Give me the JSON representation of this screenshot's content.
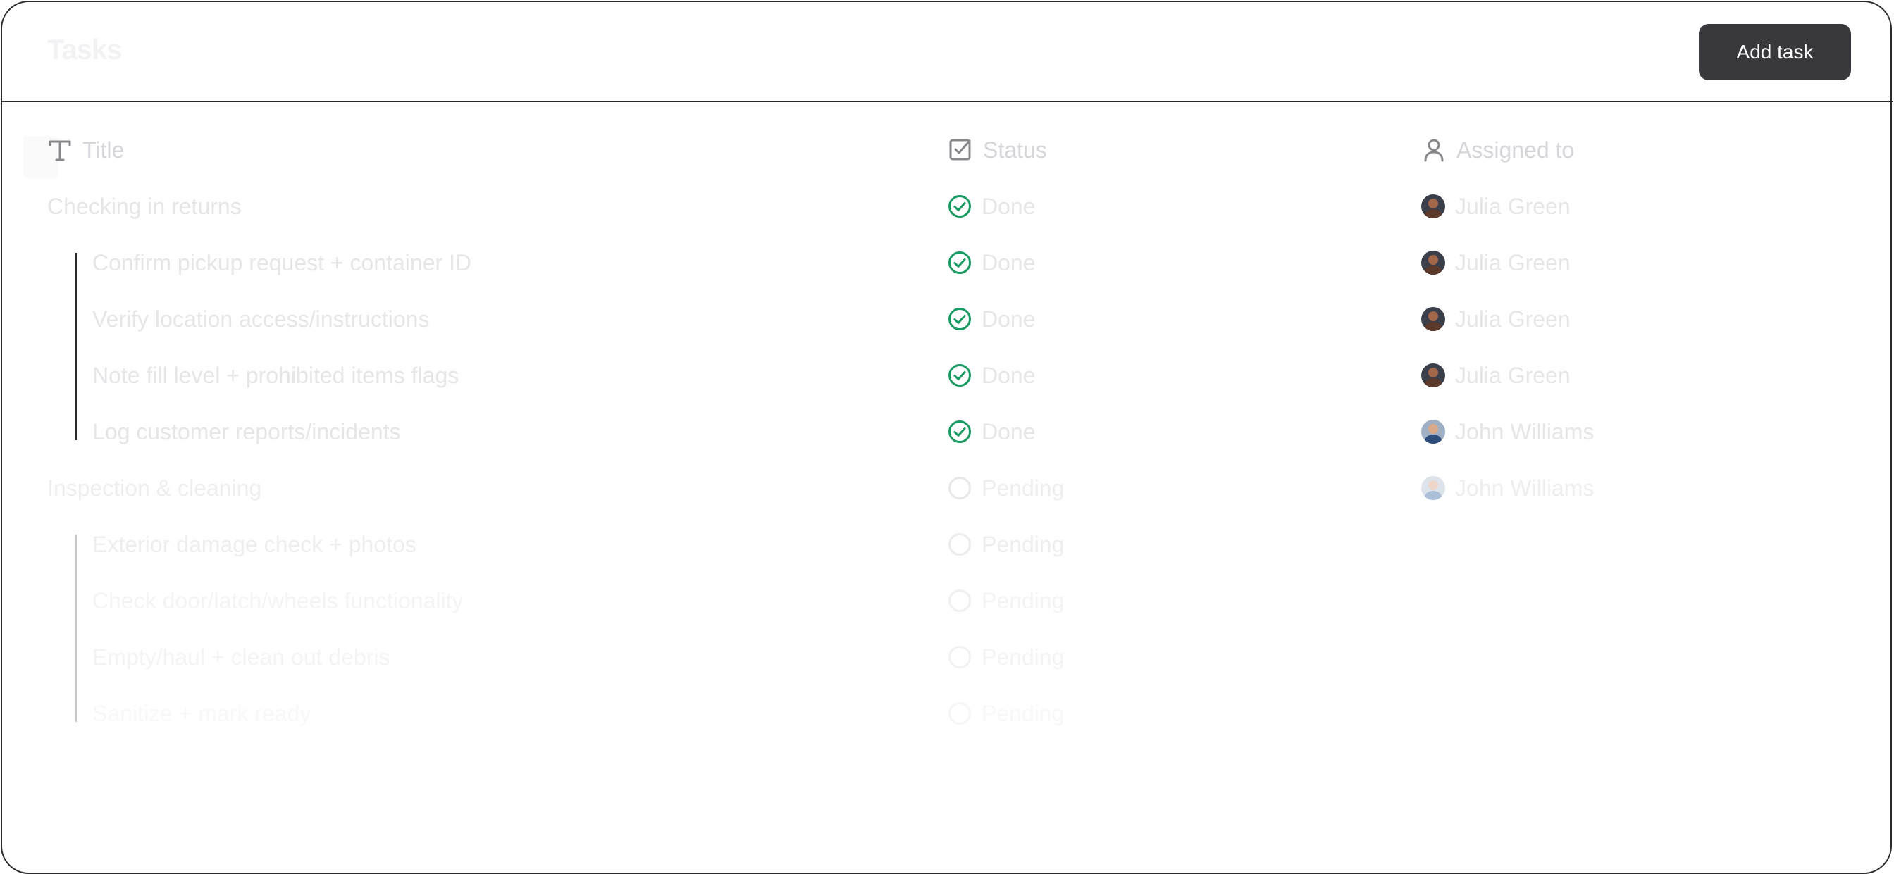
{
  "header": {
    "logo_text": "Tasks",
    "add_button_label": "Add task"
  },
  "columns": {
    "title": "Title",
    "status": "Status",
    "assigned": "Assigned to"
  },
  "rows": [
    {
      "title": "Checking in returns",
      "status": "Done",
      "assignee": "Julia Green"
    },
    {
      "title": "Confirm pickup request + container ID",
      "status": "Done",
      "assignee": "Julia Green"
    },
    {
      "title": "Verify location access/instructions",
      "status": "Done",
      "assignee": "Julia Green"
    },
    {
      "title": "Note fill level + prohibited items flags",
      "status": "Done",
      "assignee": "Julia Green"
    },
    {
      "title": "Log customer reports/incidents",
      "status": "Done",
      "assignee": "John Williams"
    },
    {
      "title": "Inspection & cleaning",
      "status": "Pending",
      "assignee": "John Williams"
    },
    {
      "title": "Exterior damage check + photos",
      "status": "Pending",
      "assignee": ""
    },
    {
      "title": "Check door/latch/wheels functionality",
      "status": "Pending",
      "assignee": ""
    },
    {
      "title": "Empty/haul + clean out debris",
      "status": "Pending",
      "assignee": ""
    },
    {
      "title": "Sanitize + mark ready",
      "status": "Pending",
      "assignee": ""
    }
  ],
  "colors": {
    "accent_done": "#1a9b63",
    "button_bg": "#39383c"
  }
}
